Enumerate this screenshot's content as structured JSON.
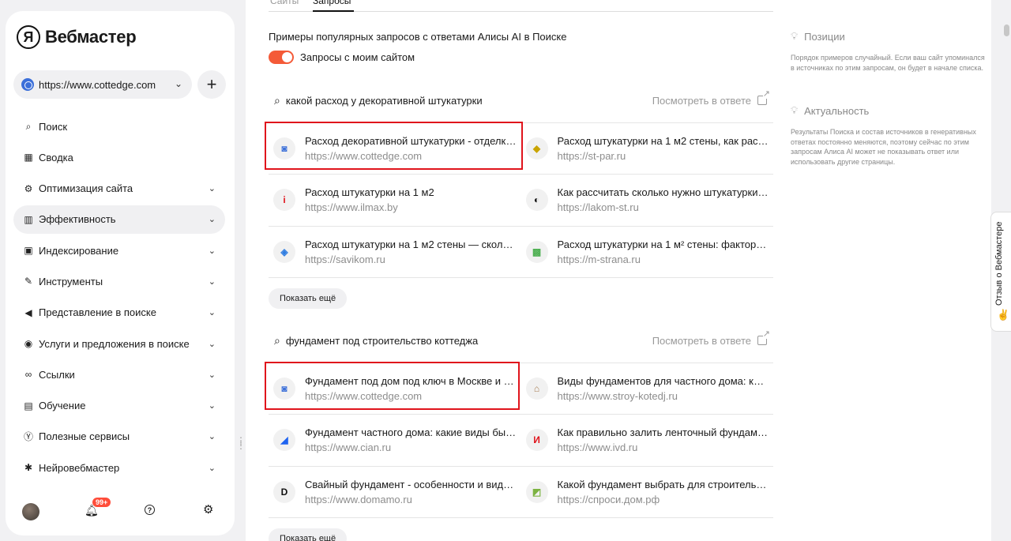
{
  "app": {
    "logo_letter": "Я",
    "logo_text": "Вебмастер"
  },
  "site_select": {
    "value": "https://www.cottedge.com",
    "add_label": "+"
  },
  "nav": [
    {
      "label": "Поиск",
      "icon": "search-icon",
      "glyph": "⌕",
      "chevron": false
    },
    {
      "label": "Сводка",
      "icon": "grid-icon",
      "glyph": "▦",
      "chevron": false
    },
    {
      "label": "Оптимизация сайта",
      "icon": "tools-icon",
      "glyph": "⚙",
      "chevron": true
    },
    {
      "label": "Эффективность",
      "icon": "chart-icon",
      "glyph": "▥",
      "chevron": true,
      "active": true
    },
    {
      "label": "Индексирование",
      "icon": "monitor-icon",
      "glyph": "▣",
      "chevron": true
    },
    {
      "label": "Инструменты",
      "icon": "wrench-icon",
      "glyph": "✎",
      "chevron": true
    },
    {
      "label": "Представление в поиске",
      "icon": "megaphone-icon",
      "glyph": "◀",
      "chevron": true
    },
    {
      "label": "Услуги и предложения в поиске",
      "icon": "cart-icon",
      "glyph": "◉",
      "chevron": true
    },
    {
      "label": "Ссылки",
      "icon": "link-icon",
      "glyph": "∞",
      "chevron": true
    },
    {
      "label": "Обучение",
      "icon": "book-icon",
      "glyph": "▤",
      "chevron": true
    },
    {
      "label": "Полезные сервисы",
      "icon": "yandex-icon",
      "glyph": "Ⓨ",
      "chevron": true
    },
    {
      "label": "Нейровебмастер",
      "icon": "neuro-icon",
      "glyph": "✱",
      "chevron": true
    }
  ],
  "bottom": {
    "badge": "99+"
  },
  "tabs": [
    "Сайты",
    "Запросы"
  ],
  "subtitle": "Примеры популярных запросов с ответами Алисы AI в Поиске",
  "toggle_label": "Запросы с моим сайтом",
  "open_answer": "Посмотреть в ответе",
  "more_label": "Показать ещё",
  "queries": [
    {
      "query": "какой расход у декоративной штукатурки",
      "results": [
        {
          "title": "Расход декоративной штукатурки - отделка...",
          "url": "https://www.cottedge.com",
          "fav": "◙",
          "fav_color": "#3b6fd9"
        },
        {
          "title": "Расход штукатурки на 1 м2 стены, как рассч...",
          "url": "https://st-par.ru",
          "fav": "◆",
          "fav_color": "#c9a400"
        },
        {
          "title": "Расход штукатурки на 1 м2",
          "url": "https://www.ilmax.by",
          "fav": "i",
          "fav_color": "#e0141c"
        },
        {
          "title": "Как рассчитать сколько нужно штукатурки ...",
          "url": "https://lakom-st.ru",
          "fav": "◐",
          "fav_color": "#111"
        },
        {
          "title": "Расход штукатурки на 1 м2 стены — сколько...",
          "url": "https://savikom.ru",
          "fav": "◈",
          "fav_color": "#2f7de1"
        },
        {
          "title": "Расход штукатурки на 1 м² стены: факторы, ...",
          "url": "https://m-strana.ru",
          "fav": "▩",
          "fav_color": "#4caf50"
        }
      ]
    },
    {
      "query": "фундамент под строительство коттеджа",
      "results": [
        {
          "title": "Фундамент под дом под ключ в Москве и М...",
          "url": "https://www.cottedge.com",
          "fav": "◙",
          "fav_color": "#3b6fd9"
        },
        {
          "title": "Виды фундаментов для частного дома: как ...",
          "url": "https://www.stroy-kotedj.ru",
          "fav": "⌂",
          "fav_color": "#a67c52"
        },
        {
          "title": "Фундамент частного дома: какие виды быв...",
          "url": "https://www.cian.ru",
          "fav": "◢",
          "fav_color": "#1e63f0"
        },
        {
          "title": "Как правильно залить ленточный фундамен...",
          "url": "https://www.ivd.ru",
          "fav": "И",
          "fav_color": "#e0141c"
        },
        {
          "title": "Свайный фундамент - особенности и виды, ...",
          "url": "https://www.domamo.ru",
          "fav": "D",
          "fav_color": "#111"
        },
        {
          "title": "Какой фундамент выбрать для строительст...",
          "url": "https://спроси.дом.рф",
          "fav": "◩",
          "fav_color": "#7cb342"
        }
      ]
    }
  ],
  "right": [
    {
      "title": "Позиции",
      "text": "Порядок примеров случайный. Если ваш сайт упоминался в источниках по этим запросам, он будет в начале списка."
    },
    {
      "title": "Актуальность",
      "text": "Результаты Поиска и состав источников в генеративных ответах постоянно меняются, поэтому сейчас по этим запросам Алиса AI может не показывать ответ или использовать другие страницы."
    }
  ],
  "feedback_label": "Отзыв о Вебмастере"
}
